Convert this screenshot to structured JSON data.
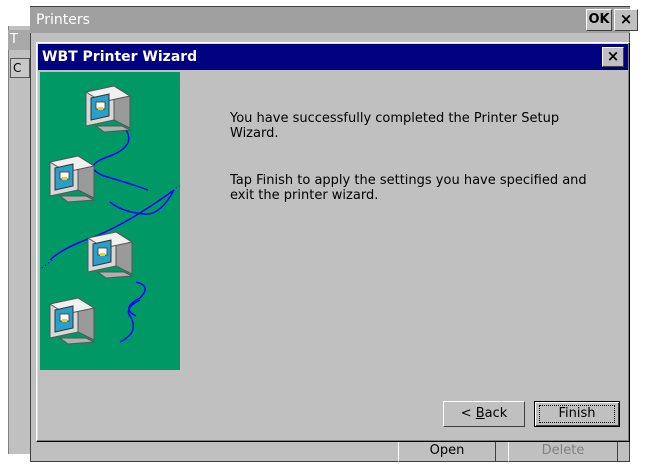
{
  "background_window": {
    "title_fragment": "T",
    "tab_fragment": "C"
  },
  "printers_window": {
    "title": "Printers",
    "ok_label": "OK",
    "close_label": "×",
    "open_label": "Open",
    "delete_label": "Delete"
  },
  "wizard": {
    "title": "WBT Printer Wizard",
    "close_label": "×",
    "message_1": "You have successfully completed the Printer Setup Wizard.",
    "message_2": "Tap Finish to apply the settings you have specified and exit the printer wizard.",
    "back_prefix": "< ",
    "back_accel": "B",
    "back_rest": "ack",
    "finish_label": "Finish",
    "illustration_bg": "#009966",
    "network_color": "#0000ff"
  }
}
